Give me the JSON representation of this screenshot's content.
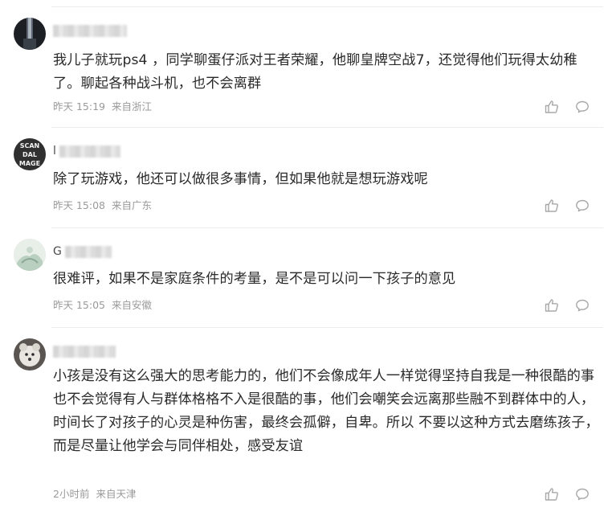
{
  "comments": [
    {
      "content": "我儿子就玩ps4 ，同学聊蛋仔派对王者荣耀，他聊皇牌空战7，还觉得他们玩得太幼稚了。聊起各种战斗机，也不会离群",
      "time": "昨天 15:19",
      "location": "来自浙江"
    },
    {
      "username_initial": "l",
      "content": "除了玩游戏，他还可以做很多事情，但如果他就是想玩游戏呢",
      "time": "昨天 15:08",
      "location": "来自广东"
    },
    {
      "username_initial": "G",
      "content": "很难评，如果不是家庭条件的考量，是不是可以问一下孩子的意见",
      "time": "昨天 15:05",
      "location": "来自安徽"
    },
    {
      "content": "小孩是没有这么强大的思考能力的，他们不会像成年人一样觉得坚持自我是一种很酷的事 也不会觉得有人与群体格格不入是很酷的事，他们会嘲笑会远离那些融不到群体中的人，时间长了对孩子的心灵是种伤害，最终会孤僻，自卑。所以 不要以这种方式去磨练孩子，而是尽量让他学会与同伴相处，感受友谊",
      "time": "2小时前",
      "location": "来自天津"
    }
  ],
  "avatar_texts": {
    "c2_line1": "SCAN",
    "c2_line2": "DAL",
    "c2_line3": "MAGE"
  },
  "icons": {
    "like": "thumbs-up-icon",
    "reply": "speech-bubble-icon"
  },
  "colors": {
    "text": "#2a2a2a",
    "meta": "#9a9a9a",
    "divider": "#ececec",
    "icon": "#a8a8a8"
  }
}
